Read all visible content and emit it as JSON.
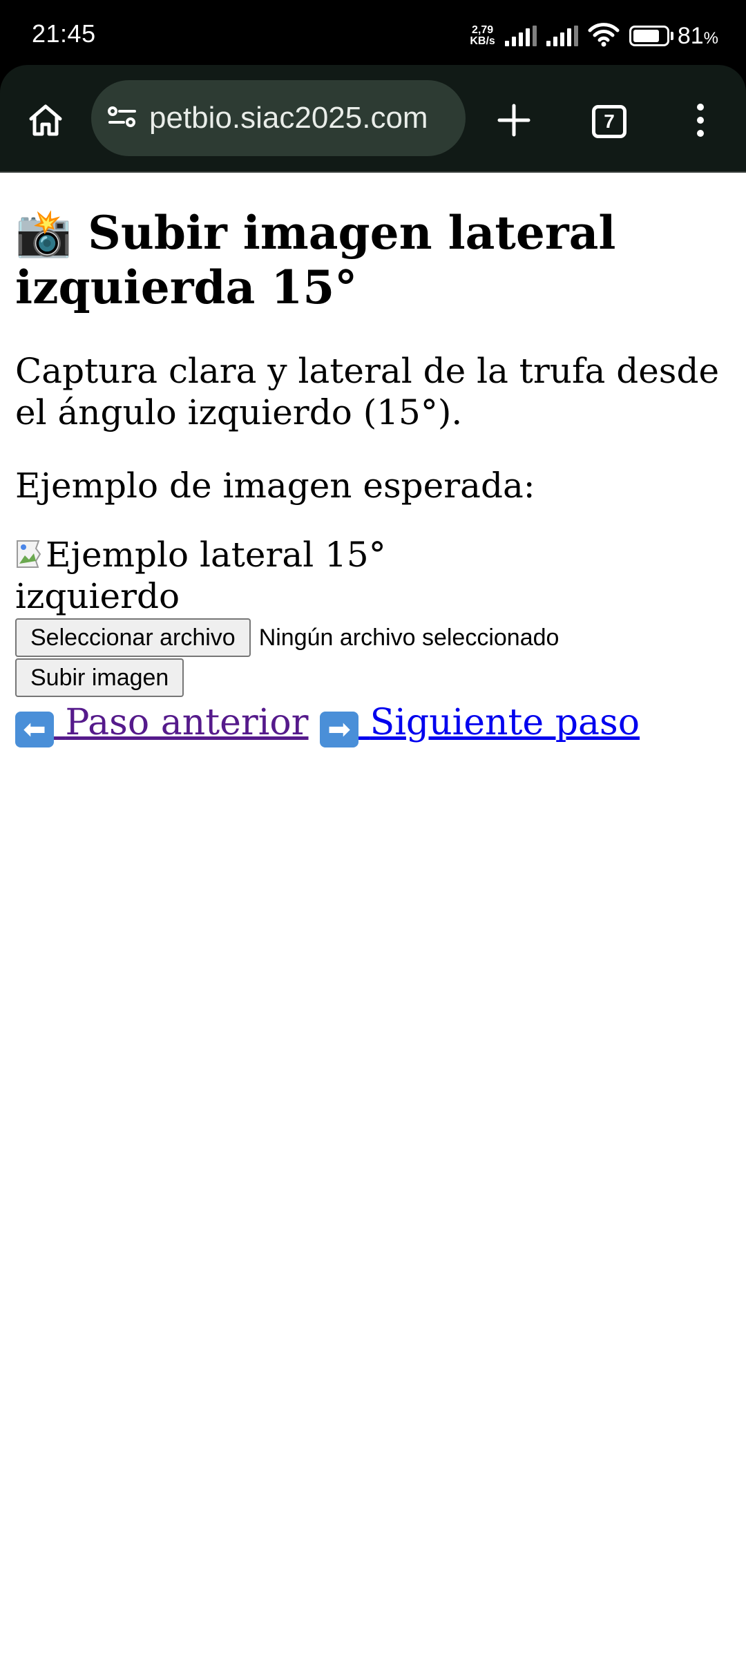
{
  "status_bar": {
    "time": "21:45",
    "net_speed_value": "2,79",
    "net_speed_unit": "KB/s",
    "battery_percent": "81",
    "battery_suffix": "%"
  },
  "browser": {
    "url": "petbio.siac2025.com",
    "tab_count": "7"
  },
  "page": {
    "title_emoji": "📸",
    "title": "Subir imagen lateral izquierda 15°",
    "description": "Captura clara y lateral de la trufa desde el ángulo izquierdo (15°).",
    "example_label": "Ejemplo de imagen esperada:",
    "example_image_alt": "Ejemplo lateral 15° izquierdo",
    "choose_file_label": "Seleccionar archivo",
    "no_file_text": "Ningún archivo seleccionado",
    "upload_label": "Subir imagen",
    "prev_arrow": "⬅",
    "prev_label": "Paso anterior",
    "next_arrow": "➡",
    "next_label": "Siguiente paso"
  }
}
